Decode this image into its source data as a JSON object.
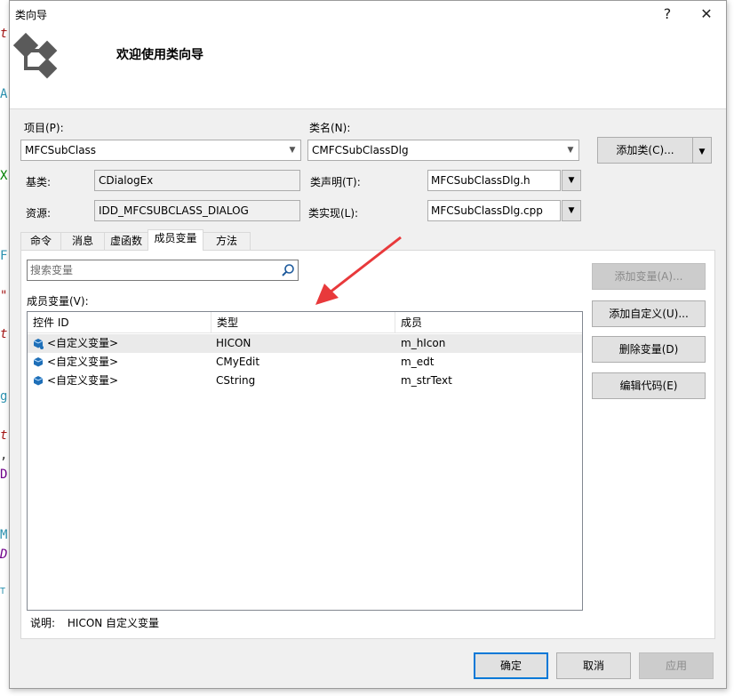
{
  "window": {
    "title": "类向导",
    "help_glyph": "?",
    "close_glyph": "✕"
  },
  "banner": {
    "welcome": "欢迎使用类向导"
  },
  "form": {
    "project_label": "项目(P):",
    "project_value": "MFCSubClass",
    "classname_label": "类名(N):",
    "classname_value": "CMFCSubClassDlg",
    "add_class_button": "添加类(C)...",
    "base_label": "基类:",
    "base_value": "CDialogEx",
    "decl_label": "类声明(T):",
    "decl_value": "MFCSubClassDlg.h",
    "resource_label": "资源:",
    "resource_value": "IDD_MFCSUBCLASS_DIALOG",
    "impl_label": "类实现(L):",
    "impl_value": "MFCSubClassDlg.cpp"
  },
  "tabs": [
    "命令",
    "消息",
    "虚函数",
    "成员变量",
    "方法"
  ],
  "active_tab": "成员变量",
  "panel": {
    "search_placeholder": "搜索变量",
    "members_label": "成员变量(V):",
    "columns": [
      "控件 ID",
      "类型",
      "成员"
    ],
    "rows": [
      {
        "id": "<自定义变量>",
        "type": "HICON",
        "member": "m_hIcon"
      },
      {
        "id": "<自定义变量>",
        "type": "CMyEdit",
        "member": "m_edt"
      },
      {
        "id": "<自定义变量>",
        "type": "CString",
        "member": "m_strText"
      }
    ],
    "desc_label": "说明:",
    "desc_value": "HICON 自定义变量",
    "buttons": {
      "add_variable": "添加变量(A)...",
      "add_custom": "添加自定义(U)...",
      "delete_variable": "删除变量(D)",
      "edit_code": "编辑代码(E)"
    }
  },
  "footer": {
    "ok": "确定",
    "cancel": "取消",
    "apply": "应用"
  },
  "colors": {
    "accent": "#0078d7",
    "arrow": "#e8393b"
  }
}
